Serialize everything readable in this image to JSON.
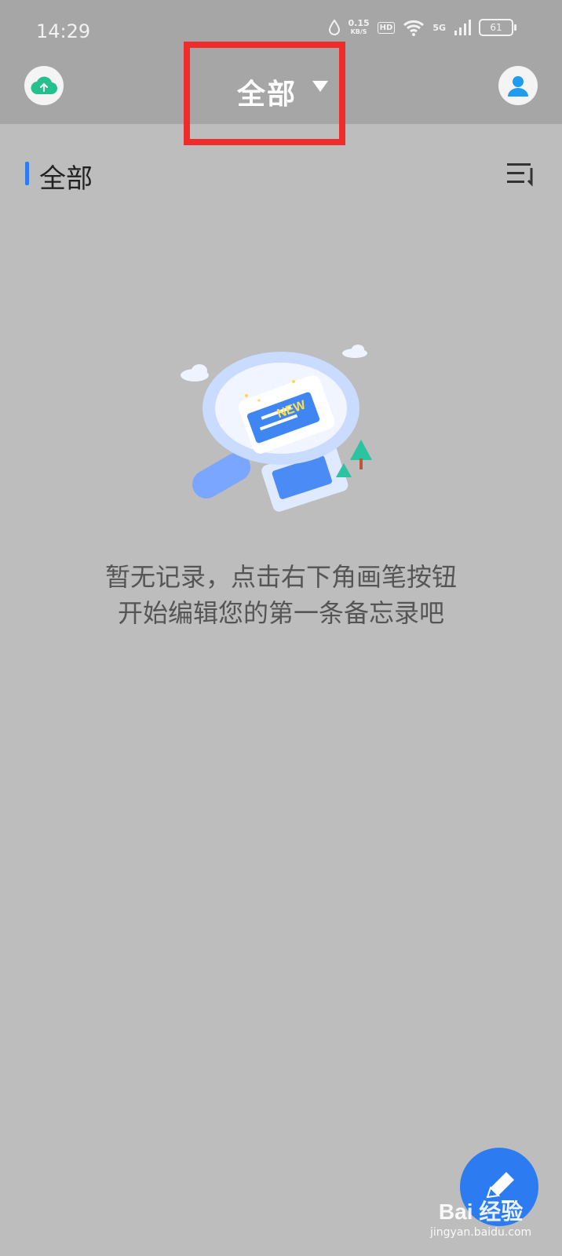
{
  "status_bar": {
    "time": "14:29",
    "net_speed_value": "0.15",
    "net_speed_unit": "KB/S",
    "hd": "HD",
    "network": "5G",
    "battery": "61"
  },
  "header": {
    "title": "全部",
    "upload_icon": "cloud-upload-icon",
    "profile_icon": "user-icon",
    "accent_color": "#2f7bf1",
    "highlight_color": "#ee2c2c"
  },
  "section": {
    "title": "全部",
    "sort_icon": "sort-list-icon"
  },
  "empty_state": {
    "line1": "暂无记录，点击右下角画笔按钮",
    "line2": "开始编辑您的第一条备忘录吧",
    "illustration_label": "NEW"
  },
  "fab": {
    "icon": "pen-icon",
    "color": "#2c7bf0"
  },
  "watermark": {
    "main": "Bai 经验",
    "sub": "jingyan.baidu.com"
  }
}
